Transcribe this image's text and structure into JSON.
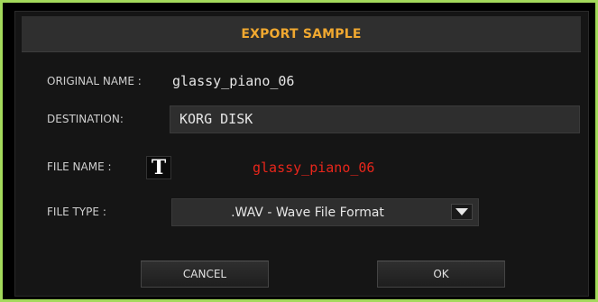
{
  "dialog": {
    "title": "EXPORT SAMPLE",
    "original_name": {
      "label": "ORIGINAL NAME :",
      "value": "glassy_piano_06"
    },
    "destination": {
      "label": "DESTINATION:",
      "value": "KORG DISK"
    },
    "file_name": {
      "label": "FILE NAME :",
      "edit_button_glyph": "T",
      "value": "glassy_piano_06"
    },
    "file_type": {
      "label": "FILE TYPE :",
      "selected": ".WAV - Wave File Format"
    },
    "buttons": {
      "cancel": "CANCEL",
      "ok": "OK"
    }
  },
  "colors": {
    "title": "#f0a830",
    "file_name_value": "#e8261b",
    "frame_highlight": "#a3d95b"
  },
  "icons": {
    "file_name_edit": "text-edit-icon",
    "file_type_dropdown": "chevron-down-icon"
  }
}
